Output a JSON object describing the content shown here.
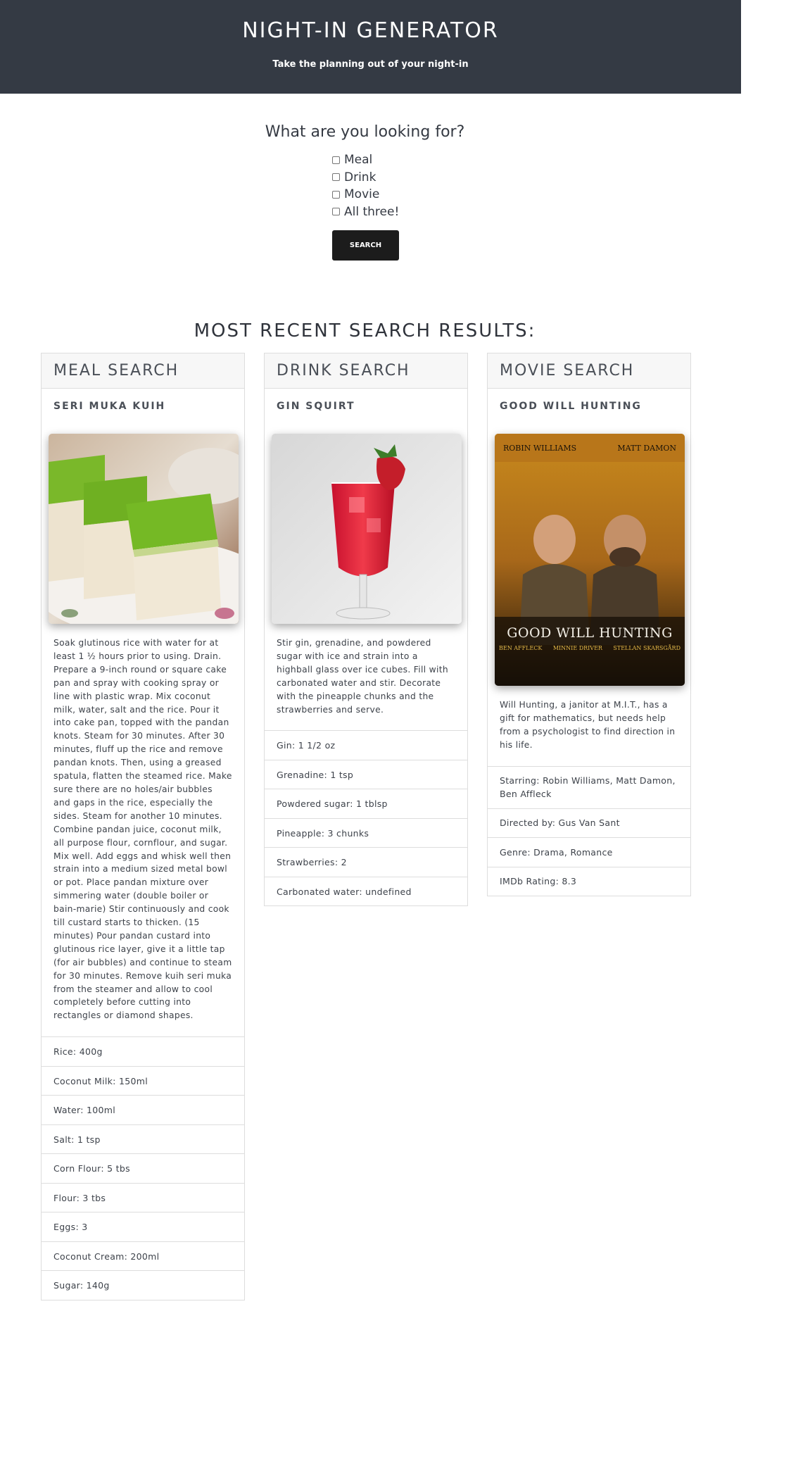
{
  "header": {
    "title": "NIGHT-IN GENERATOR",
    "tagline": "Take the planning out of your night-in"
  },
  "search": {
    "prompt": "What are you looking for?",
    "options": [
      "Meal",
      "Drink",
      "Movie",
      "All three!"
    ],
    "button_label": "SEARCH"
  },
  "results": {
    "title": "MOST RECENT SEARCH RESULTS:",
    "meal": {
      "header": "MEAL SEARCH",
      "name": "SERI MUKA KUIH",
      "instructions": "Soak glutinous rice with water for at least 1 ½ hours prior to using. Drain. Prepare a 9-inch round or square cake pan and spray with cooking spray or line with plastic wrap. Mix coconut milk, water, salt and the rice. Pour it into cake pan, topped with the pandan knots. Steam for 30 minutes. After 30 minutes, fluff up the rice and remove pandan knots. Then, using a greased spatula, flatten the steamed rice. Make sure there are no holes/air bubbles and gaps in the rice, especially the sides. Steam for another 10 minutes. Combine pandan juice, coconut milk, all purpose flour, cornflour, and sugar. Mix well. Add eggs and whisk well then strain into a medium sized metal bowl or pot. Place pandan mixture over simmering water (double boiler or bain-marie) Stir continuously and cook till custard starts to thicken. (15 minutes) Pour pandan custard into glutinous rice layer, give it a little tap (for air bubbles) and continue to steam for 30 minutes. Remove kuih seri muka from the steamer and allow to cool completely before cutting into rectangles or diamond shapes.",
      "ingredients": [
        "Rice: 400g",
        "Coconut Milk: 150ml",
        "Water: 100ml",
        "Salt: 1 tsp",
        "Corn Flour: 5 tbs",
        "Flour: 3 tbs",
        "Eggs: 3",
        "Coconut Cream: 200ml",
        "Sugar: 140g"
      ]
    },
    "drink": {
      "header": "DRINK SEARCH",
      "name": "GIN SQUIRT",
      "instructions": "Stir gin, grenadine, and powdered sugar with ice and strain into a highball glass over ice cubes. Fill with carbonated water and stir. Decorate with the pineapple chunks and the strawberries and serve.",
      "ingredients": [
        "Gin: 1 1/2 oz",
        "Grenadine: 1 tsp",
        "Powdered sugar: 1 tblsp",
        "Pineapple: 3 chunks",
        "Strawberries: 2",
        "Carbonated water: undefined"
      ]
    },
    "movie": {
      "header": "MOVIE SEARCH",
      "name": "GOOD WILL HUNTING",
      "plot": "Will Hunting, a janitor at M.I.T., has a gift for mathematics, but needs help from a psychologist to find direction in his life.",
      "details": [
        "Starring: Robin Williams, Matt Damon, Ben Affleck",
        "Directed by: Gus Van Sant",
        "Genre: Drama, Romance",
        "IMDb Rating: 8.3"
      ],
      "poster": {
        "actors_left": "ROBIN WILLIAMS",
        "actors_right": "MATT DAMON",
        "title": "GOOD WILL HUNTING",
        "cast_line": [
          "BEN AFFLECK",
          "MINNIE DRIVER",
          "STELLAN SKARSGÅRD"
        ]
      }
    }
  }
}
